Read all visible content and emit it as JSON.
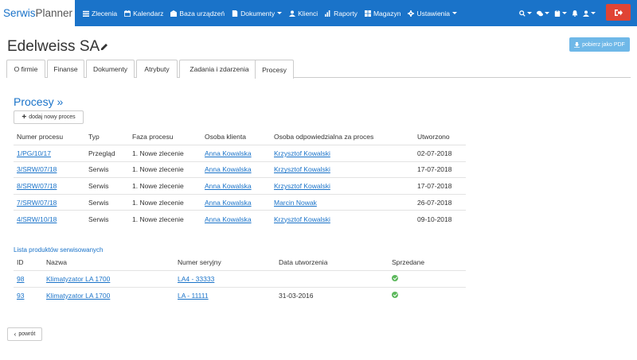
{
  "brand": {
    "part1": "Serwis",
    "part2": "Planner"
  },
  "nav": [
    {
      "label": "Zlecenia",
      "icon": "list-icon"
    },
    {
      "label": "Kalendarz",
      "icon": "calendar-icon"
    },
    {
      "label": "Baza urządzeń",
      "icon": "building-icon"
    },
    {
      "label": "Dokumenty",
      "icon": "document-icon",
      "dropdown": true
    },
    {
      "label": "Klienci",
      "icon": "user-icon"
    },
    {
      "label": "Raporty",
      "icon": "bar-chart-icon"
    },
    {
      "label": "Magazyn",
      "icon": "warehouse-icon"
    },
    {
      "label": "Ustawienia",
      "icon": "gear-icon",
      "dropdown": true
    }
  ],
  "colors": {
    "navbar": "#1a73c9",
    "logout": "#e04434",
    "pdf": "#6fb8e8",
    "link": "#1a73c9",
    "check": "#5cb85c"
  },
  "page": {
    "title": "Edelweiss SA",
    "pdf_label": "pobierz jako PDF",
    "tabs": [
      "O firmie",
      "Finanse",
      "Dokumenty",
      "Atrybuty",
      "Zadania i zdarzenia",
      "Procesy"
    ],
    "active_tab": "Procesy"
  },
  "processes": {
    "title": "Procesy »",
    "add_label": "dodaj nowy proces",
    "headers": [
      "Numer procesu",
      "Typ",
      "Faza procesu",
      "Osoba klienta",
      "Osoba odpowiedzialna za proces",
      "Utworzono"
    ],
    "rows": [
      [
        "1/PG/10/17",
        "Przegląd",
        "1. Nowe zlecenie",
        "Anna Kowalska",
        "Krzysztof Kowalski",
        "02-07-2018"
      ],
      [
        "3/SRW/07/18",
        "Serwis",
        "1. Nowe zlecenie",
        "Anna Kowalska",
        "Krzysztof Kowalski",
        "17-07-2018"
      ],
      [
        "8/SRW/07/18",
        "Serwis",
        "1. Nowe zlecenie",
        "Anna Kowalska",
        "Krzysztof Kowalski",
        "17-07-2018"
      ],
      [
        "7/SRW/07/18",
        "Serwis",
        "1. Nowe zlecenie",
        "Anna Kowalska",
        "Marcin Nowak",
        "26-07-2018"
      ],
      [
        "4/SRW/10/18",
        "Serwis",
        "1. Nowe zlecenie",
        "Anna Kowalska",
        "Krzysztof Kowalski",
        "09-10-2018"
      ]
    ]
  },
  "products": {
    "title": "Lista produktów serwisowanych",
    "headers": [
      "ID",
      "Nazwa",
      "Numer seryjny",
      "Data utworzenia",
      "Sprzedane"
    ],
    "rows": [
      [
        "98",
        "Klimatyzator LA 1700",
        "LA4 - 33333",
        "",
        "check"
      ],
      [
        "93",
        "Klimatyzator LA 1700",
        "LA - 11111",
        "31-03-2016",
        "check"
      ]
    ]
  },
  "back_label": "powrót"
}
